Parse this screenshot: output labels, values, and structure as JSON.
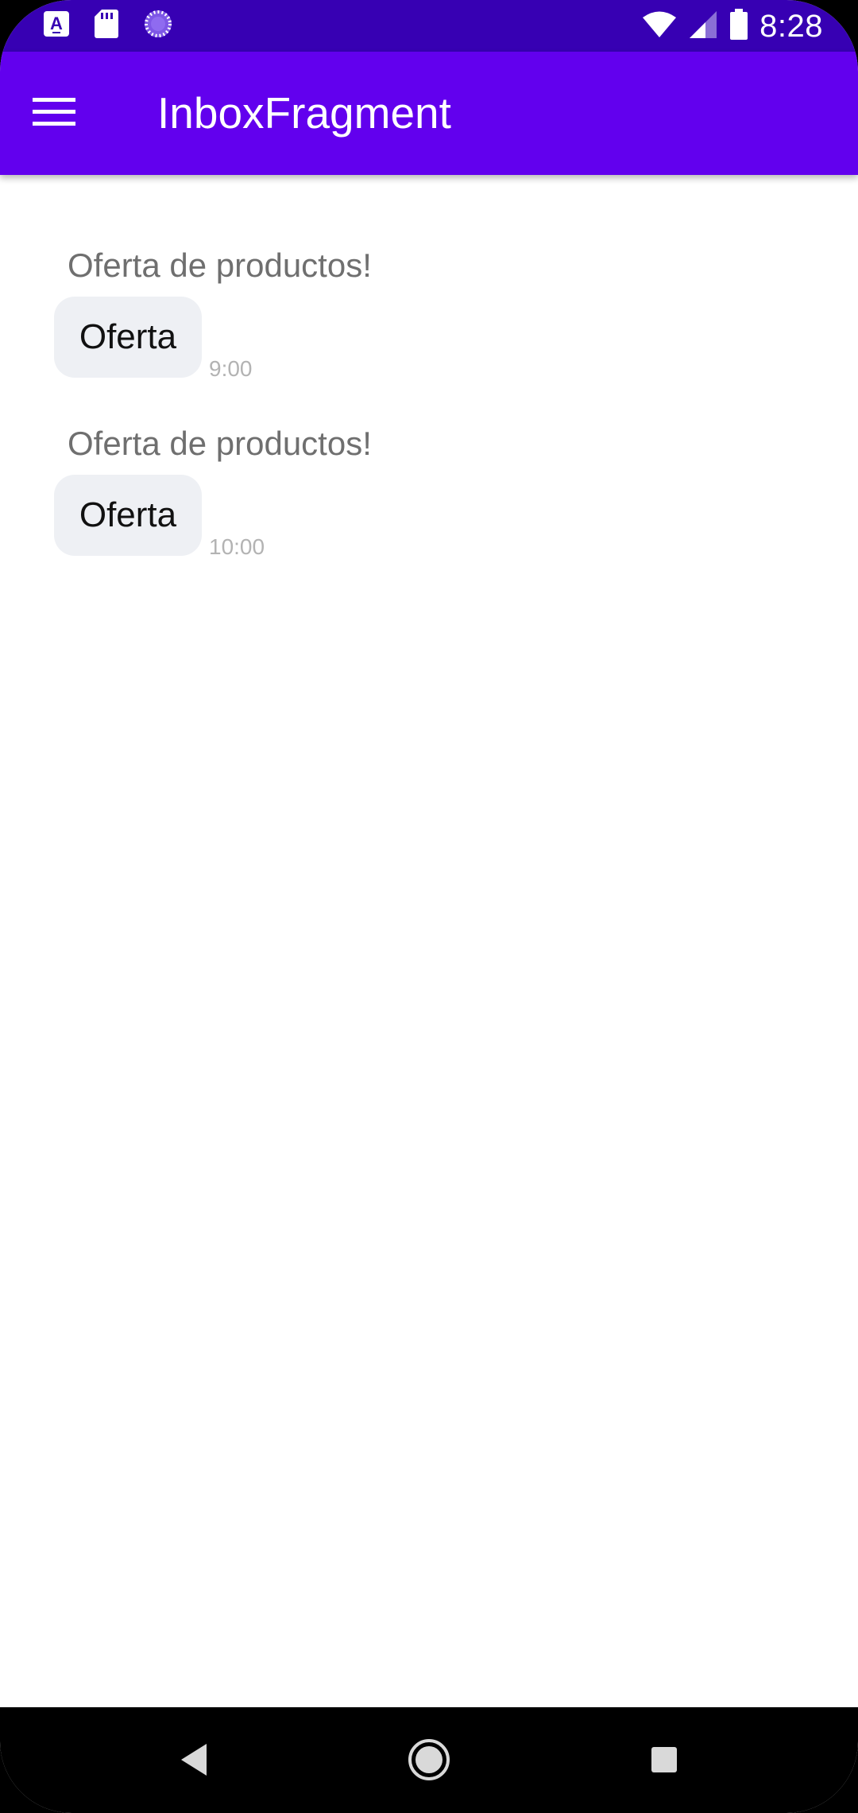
{
  "status_bar": {
    "time": "8:28",
    "left_icons": [
      "text-a-notification-icon",
      "sd-card-icon",
      "loading-spinner-icon"
    ],
    "right_icons": [
      "wifi-icon",
      "cell-signal-icon",
      "battery-icon"
    ]
  },
  "app_bar": {
    "title": "InboxFragment",
    "menu_icon": "hamburger-menu-icon"
  },
  "messages": [
    {
      "title": "Oferta de productos!",
      "body": "Oferta",
      "time": "9:00"
    },
    {
      "title": "Oferta de productos!",
      "body": "Oferta",
      "time": "10:00"
    }
  ],
  "nav_bar": {
    "buttons": [
      "back-icon",
      "home-icon",
      "recents-icon"
    ]
  },
  "colors": {
    "status_bar": "#3700b3",
    "app_bar": "#6200ee",
    "bubble": "#eef0f4",
    "title_text": "#6f6f6f",
    "time_text": "#b3b3b3"
  }
}
